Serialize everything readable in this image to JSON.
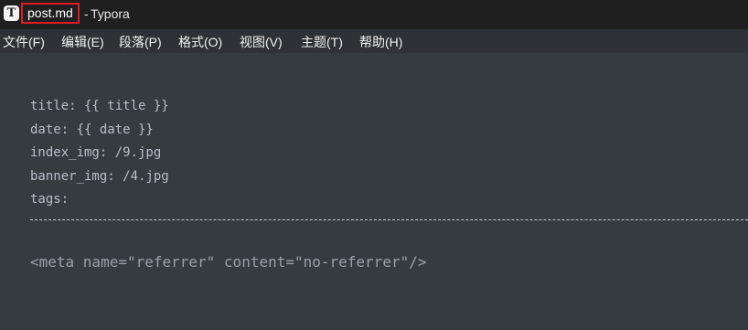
{
  "window": {
    "app_icon_glyph": "T",
    "file_name": "post.md",
    "separator": "-",
    "app_name": "Typora"
  },
  "menu": {
    "items": [
      "文件(F)",
      "编辑(E)",
      "段落(P)",
      "格式(O)",
      "视图(V)",
      "主题(T)",
      "帮助(H)"
    ]
  },
  "editor": {
    "front_matter": [
      "title: {{ title }}",
      "date: {{ date }}",
      "index_img: /9.jpg",
      "banner_img: /4.jpg",
      "tags:"
    ],
    "html_block": "<meta name=\"referrer\" content=\"no-referrer\"/>"
  },
  "colors": {
    "titlebar_bg": "#1f1f1f",
    "menubar_bg": "#2e3135",
    "editor_bg": "#363b40",
    "highlight_border": "#e01b24"
  }
}
